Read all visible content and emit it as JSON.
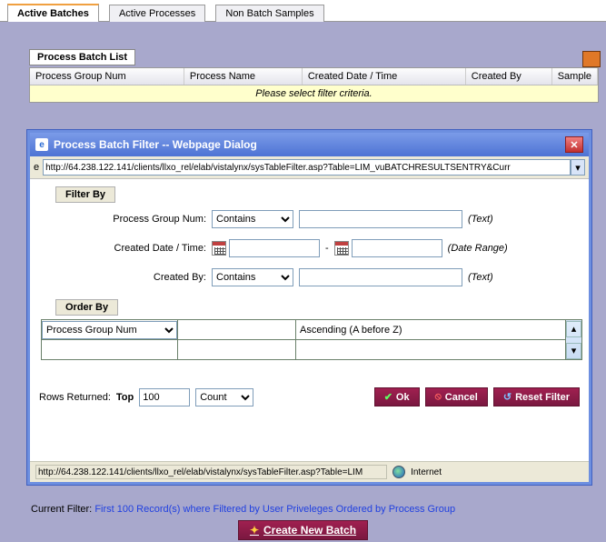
{
  "tabs": {
    "items": [
      "Active Batches",
      "Active Processes",
      "Non Batch Samples"
    ],
    "active_index": 0
  },
  "panel": {
    "title": "Process Batch List",
    "columns": [
      "Process Group Num",
      "Process Name",
      "Created Date / Time",
      "Created By",
      "Sample"
    ],
    "criteria_msg": "Please select filter criteria."
  },
  "dialog": {
    "title": "Process Batch Filter  --  Webpage Dialog",
    "address": "http://64.238.122.141/clients/llxo_rel/elab/vistalynx/sysTableFilter.asp?Table=LIM_vuBATCHRESULTSENTRY&Curr",
    "filter_by_label": "Filter By",
    "rows": {
      "pgn": {
        "label": "Process Group Num:",
        "op": "Contains",
        "hint": "(Text)"
      },
      "cdt": {
        "label": "Created Date / Time:",
        "hint": "(Date Range)",
        "dash": "-"
      },
      "cby": {
        "label": "Created By:",
        "op": "Contains",
        "hint": "(Text)"
      }
    },
    "order_by_label": "Order By",
    "order": {
      "field": "Process Group Num",
      "direction": "Ascending (A before Z)"
    },
    "rows_returned_label": "Rows Returned:",
    "top_label": "Top",
    "top_value": "100",
    "count_label": "Count",
    "buttons": {
      "ok": "Ok",
      "cancel": "Cancel",
      "reset": "Reset Filter"
    },
    "status_url": "http://64.238.122.141/clients/llxo_rel/elab/vistalynx/sysTableFilter.asp?Table=LIM",
    "status_zone": "Internet"
  },
  "footer": {
    "label": "Current Filter:",
    "value": "First 100 Record(s) where Filtered by User Priveleges Ordered by Process Group",
    "create_label": "Create New Batch"
  }
}
